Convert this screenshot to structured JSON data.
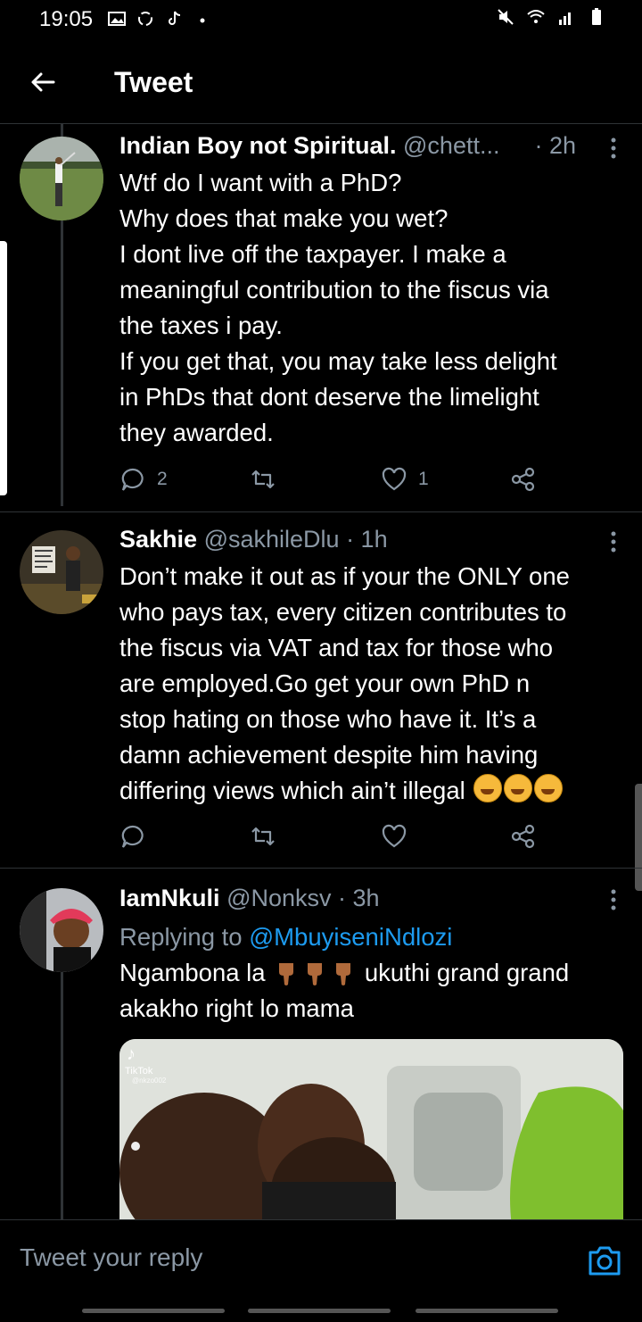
{
  "status_bar": {
    "time": "19:05"
  },
  "header": {
    "title": "Tweet"
  },
  "tweets": [
    {
      "author": "Indian Boy not Spiritual.",
      "handle": "@chett...",
      "time": "· 2h",
      "lines": [
        "Wtf do I want with a PhD?",
        "Why does that make you wet?",
        "I dont live off the taxpayer. I make a",
        "meaningful contribution to the fiscus via",
        "the taxes i pay.",
        "If you get that, you may take less delight",
        "in PhDs that dont deserve the limelight",
        "they awarded."
      ],
      "reply_count": "2",
      "retweet_count": "",
      "like_count": "1"
    },
    {
      "author": "Sakhie",
      "handle": "@sakhileDlu",
      "time": "· 1h",
      "lines": [
        "Don’t make it out as if your the ONLY one",
        "who pays tax, every citizen contributes to",
        "the fiscus via VAT and tax for those who",
        "are employed.Go get your own PhD n",
        "stop hating on those who have it. It’s a",
        "damn achievement despite him having",
        "differing views which ain’t illegal"
      ],
      "emoji_count": 3,
      "reply_count": "",
      "retweet_count": "",
      "like_count": ""
    },
    {
      "author": "IamNkuli",
      "handle": "@Nonksv",
      "time": "· 3h",
      "replying_prefix": "Replying to",
      "replying_to": "@MbuyiseniNdlozi",
      "line1_start": "Ngambona la",
      "line1_end": "ukuthi grand grand",
      "line2": "akakho right lo mama",
      "media": {
        "watermark": "TikTok",
        "watermark_user": "@nkzo002"
      }
    }
  ],
  "reply_bar": {
    "placeholder": "Tweet your reply"
  },
  "colors": {
    "accent": "#1d9bf0",
    "muted": "#8b98a5",
    "background": "#000000",
    "divider": "#2f3336"
  },
  "icons": [
    "back-arrow-icon",
    "more-icon",
    "reply-icon",
    "retweet-icon",
    "like-icon",
    "share-icon",
    "camera-icon",
    "rofl-emoji",
    "pointing-down-emoji"
  ]
}
